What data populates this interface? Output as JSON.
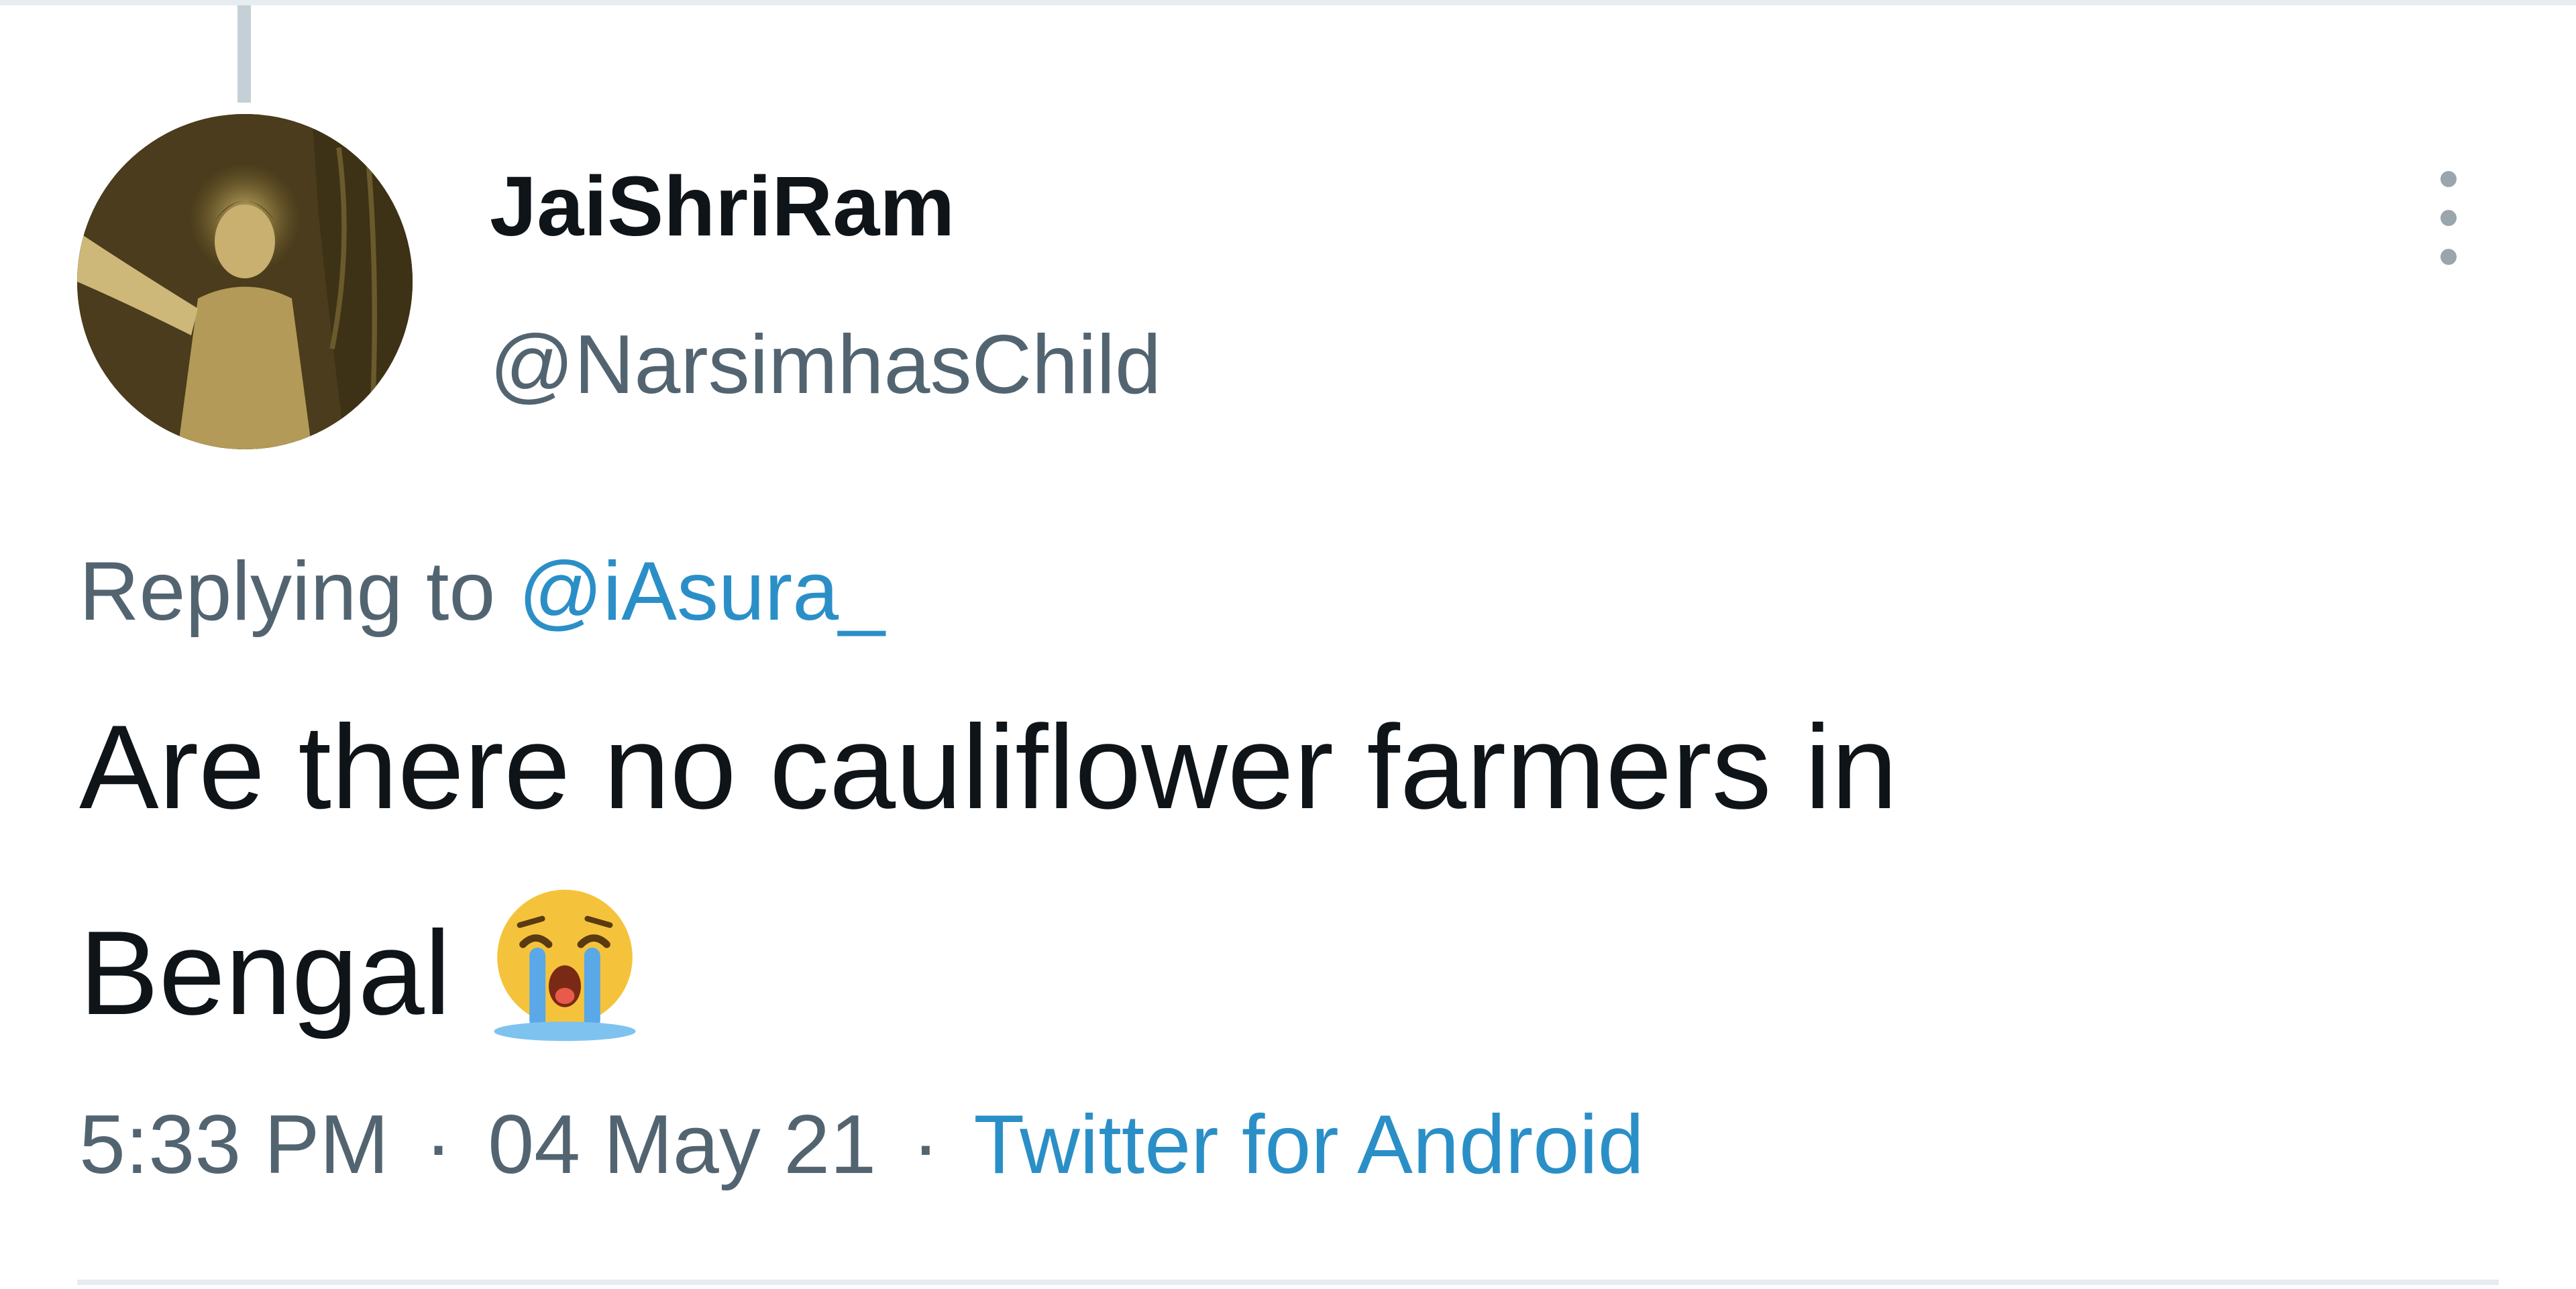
{
  "tweet": {
    "display_name": "JaiShriRam",
    "handle": "@NarsimhasChild",
    "replying_prefix": "Replying to",
    "replying_to": "@iAsura_",
    "text_line1": "Are there no cauliflower farmers in",
    "text_line2": "Bengal",
    "emoji": "loudly-crying-face",
    "time": "5:33 PM",
    "date": "04 May 21",
    "separator": "·",
    "source": "Twitter for Android"
  },
  "icons": {
    "more": "more-vertical-icon",
    "avatar": "profile-avatar-image"
  },
  "colors": {
    "text_primary": "#0f1419",
    "text_secondary": "#536471",
    "link": "#2b8fc7",
    "divider": "#e6ecf0"
  }
}
